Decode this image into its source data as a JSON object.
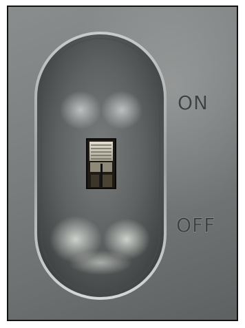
{
  "labels": {
    "on": "ON",
    "off": "OFF"
  },
  "switch": {
    "position": "on"
  },
  "colors": {
    "panel": "#7e8181",
    "recess": "#5a5d5d",
    "label": "#3f4242",
    "switch_slot": "#1e1a14",
    "switch_knob": "#c9c5b6"
  }
}
